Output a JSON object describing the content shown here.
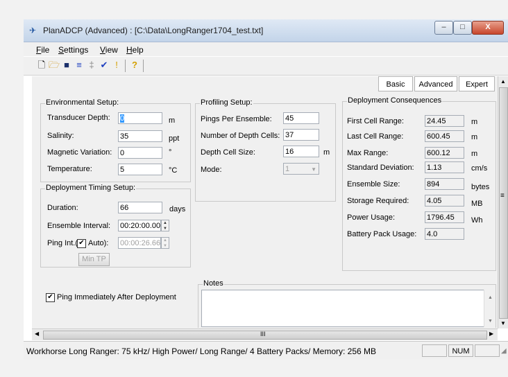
{
  "window": {
    "title": "PlanADCP (Advanced) : [C:\\Data\\LongRanger1704_test.txt]",
    "minimize": "–",
    "maximize": "□",
    "close": "X"
  },
  "menu": [
    "File",
    "Settings",
    "View",
    "Help"
  ],
  "toolbar_icons": [
    "new-file-icon",
    "open-folder-icon",
    "save-icon",
    "adcp-icon",
    "depth-cells-icon",
    "check-icon",
    "hint-icon",
    "help-icon"
  ],
  "tabs": {
    "basic": "Basic",
    "advanced": "Advanced",
    "expert": "Expert"
  },
  "environmental": {
    "title": "Environmental Setup:",
    "transducer_depth": {
      "label": "Transducer Depth:",
      "value": "0",
      "unit": "m"
    },
    "salinity": {
      "label": "Salinity:",
      "value": "35",
      "unit": "ppt"
    },
    "magnetic_variation": {
      "label": "Magnetic Variation:",
      "value": "0",
      "unit": "°"
    },
    "temperature": {
      "label": "Temperature:",
      "value": "5",
      "unit": "°C"
    }
  },
  "timing": {
    "title": "Deployment Timing Setup:",
    "duration": {
      "label": "Duration:",
      "value": "66",
      "unit": "days"
    },
    "ensemble_interval": {
      "label": "Ensemble Interval:",
      "value": "00:20:00.00"
    },
    "ping_int": {
      "label_prefix": "Ping Int.(",
      "auto_label": "Auto):",
      "auto_checked": "✔",
      "value": "00:00:26.66"
    },
    "min_tp": "Min TP"
  },
  "ping_immediately": {
    "label": "Ping Immediately After Deployment",
    "checked": "✔"
  },
  "profiling": {
    "title": "Profiling Setup:",
    "pings_per_ensemble": {
      "label": "Pings Per Ensemble:",
      "value": "45"
    },
    "number_of_depth_cells": {
      "label": "Number of Depth Cells:",
      "value": "37"
    },
    "depth_cell_size": {
      "label": "Depth Cell Size:",
      "value": "16",
      "unit": "m"
    },
    "mode": {
      "label": "Mode:",
      "value": "1"
    }
  },
  "consequences": {
    "title": "Deployment Consequences",
    "rows": [
      {
        "label": "First Cell Range:",
        "value": "24.45",
        "unit": "m"
      },
      {
        "label": "Last Cell Range:",
        "value": "600.45",
        "unit": "m"
      },
      {
        "label": "Max Range:",
        "value": "600.12",
        "unit": "m"
      },
      {
        "label": "Standard Deviation:",
        "value": "1.13",
        "unit": "cm/s"
      },
      {
        "label": "Ensemble Size:",
        "value": "894",
        "unit": "bytes"
      },
      {
        "label": "Storage Required:",
        "value": "4.05",
        "unit": "MB"
      },
      {
        "label": "Power Usage:",
        "value": "1796.45",
        "unit": "Wh"
      },
      {
        "label": "Battery Pack Usage:",
        "value": "4.0",
        "unit": ""
      }
    ]
  },
  "notes": {
    "title": "Notes",
    "value": ""
  },
  "status": {
    "text": "Workhorse Long Ranger: 75 kHz/ High Power/ Long Range/ 4 Battery Packs/ Memory: 256 MB",
    "num": "NUM"
  },
  "scroll": {
    "h_thumb": "III",
    "v_thumb": "≡"
  }
}
